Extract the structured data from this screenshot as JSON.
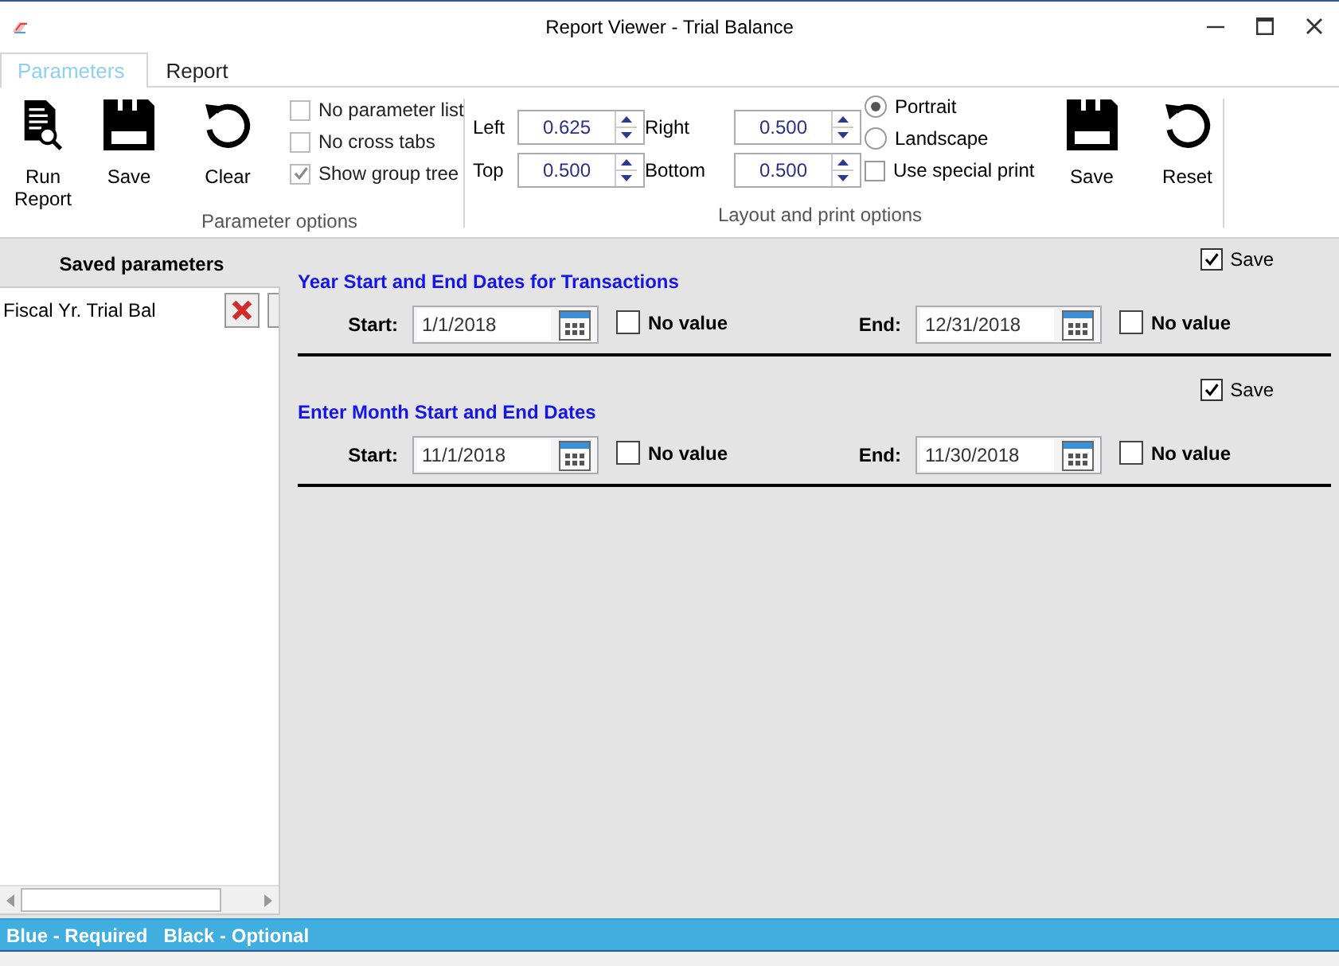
{
  "window": {
    "title": "Report Viewer - Trial Balance"
  },
  "tabs": [
    {
      "label": "Parameters",
      "selected": true
    },
    {
      "label": "Report",
      "selected": false
    }
  ],
  "parameter_options": {
    "buttons": [
      {
        "kind": "run",
        "label": "Run Report"
      },
      {
        "kind": "save",
        "label": "Save"
      },
      {
        "kind": "clear",
        "label": "Clear"
      }
    ],
    "checkboxes": [
      {
        "label": "No parameter list",
        "checked": false
      },
      {
        "label": "No cross tabs",
        "checked": false
      },
      {
        "label": "Show group tree",
        "checked": true
      }
    ],
    "caption": "Parameter options"
  },
  "layout_options": {
    "margins": [
      {
        "label": "Left",
        "value": "0.625"
      },
      {
        "label": "Right",
        "value": "0.500"
      },
      {
        "label": "Top",
        "value": "0.500"
      },
      {
        "label": "Bottom",
        "value": "0.500"
      }
    ],
    "orientation": [
      {
        "label": "Portrait",
        "selected": true
      },
      {
        "label": "Landscape",
        "selected": false
      }
    ],
    "special_print": {
      "label": "Use special print",
      "checked": false
    },
    "buttons": [
      {
        "kind": "save",
        "label": "Save"
      },
      {
        "kind": "reset",
        "label": "Reset"
      }
    ],
    "caption": "Layout and print options"
  },
  "saved_parameters": {
    "title": "Saved parameters",
    "items": [
      {
        "label": "Fiscal Yr. Trial Bal"
      }
    ]
  },
  "sections": [
    {
      "title": "Year Start and End Dates for Transactions",
      "save": {
        "label": "Save",
        "checked": true
      },
      "fields": [
        {
          "label": "Start:",
          "value": "1/1/2018",
          "no_value": {
            "label": "No value",
            "checked": false
          }
        },
        {
          "label": "End:",
          "value": "12/31/2018",
          "no_value": {
            "label": "No value",
            "checked": false
          }
        }
      ]
    },
    {
      "title": "Enter Month Start and End Dates",
      "save": {
        "label": "Save",
        "checked": true
      },
      "fields": [
        {
          "label": "Start:",
          "value": "11/1/2018",
          "no_value": {
            "label": "No value",
            "checked": false
          }
        },
        {
          "label": "End:",
          "value": "11/30/2018",
          "no_value": {
            "label": "No value",
            "checked": false
          }
        }
      ]
    }
  ],
  "status_bar": {
    "items": [
      "Blue - Required",
      "Black - Optional"
    ]
  }
}
